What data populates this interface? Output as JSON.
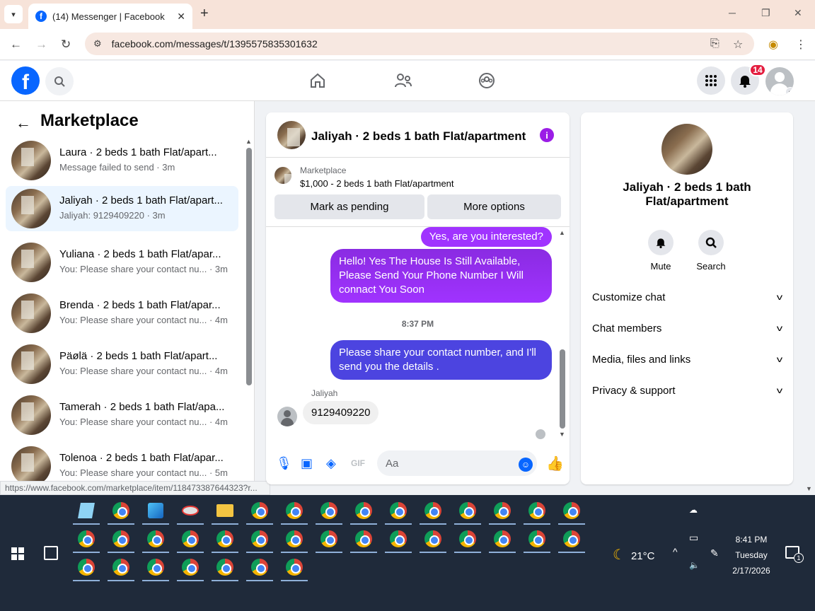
{
  "browser": {
    "tab_title": "(14) Messenger | Facebook",
    "url": "facebook.com/messages/t/1395575835301632",
    "status_url": "https://www.facebook.com/marketplace/item/118473387644323?r..."
  },
  "header": {
    "notification_count": "14"
  },
  "sidebar": {
    "title": "Marketplace",
    "conversations": [
      {
        "name": "Laura · 2 beds 1 bath Flat/apart...",
        "preview": "Message failed to send · 3m"
      },
      {
        "name": "Jaliyah · 2 beds 1 bath Flat/apart...",
        "preview": "Jaliyah: 9129409220 · 3m"
      },
      {
        "name": "Yuliana · 2 beds 1 bath Flat/apar...",
        "preview": "You: Please share your contact nu...  · 3m"
      },
      {
        "name": "Brenda · 2 beds 1 bath Flat/apar...",
        "preview": "You: Please share your contact nu...  · 4m"
      },
      {
        "name": "Päølä · 2 beds 1 bath Flat/apart...",
        "preview": "You: Please share your contact nu...  · 4m"
      },
      {
        "name": "Tamerah · 2 beds 1 bath Flat/apa...",
        "preview": "You: Please share your contact nu...  · 4m"
      },
      {
        "name": "Tolenoa · 2 beds 1 bath Flat/apar...",
        "preview": "You: Please share your contact nu...  · 5m"
      }
    ]
  },
  "chat": {
    "title": "Jaliyah · 2 beds 1 bath Flat/apartment",
    "marketplace_label": "Marketplace",
    "listing": "$1,000 - 2 beds 1 bath Flat/apartment",
    "mark_pending": "Mark as pending",
    "more_options": "More options",
    "messages": {
      "m1": "Yes, are you interested?",
      "m2": "Hello! Yes The House Is Still Available, Please Send Your Phone Number I Will connact You Soon",
      "time": "8:37 PM",
      "m3": "Please share your contact number, and I'll send you the details .",
      "sender": "Jaliyah",
      "m4": "9129409220"
    },
    "composer_placeholder": "Aa"
  },
  "details": {
    "name": "Jaliyah · 2 beds 1 bath Flat/apartment",
    "mute": "Mute",
    "search": "Search",
    "rows": [
      "Customize chat",
      "Chat members",
      "Media, files and links",
      "Privacy & support"
    ]
  },
  "taskbar": {
    "weather": "21°C",
    "time": "8:41 PM",
    "day": "Tuesday",
    "date": "2/17/2026",
    "notif_count": "1"
  }
}
